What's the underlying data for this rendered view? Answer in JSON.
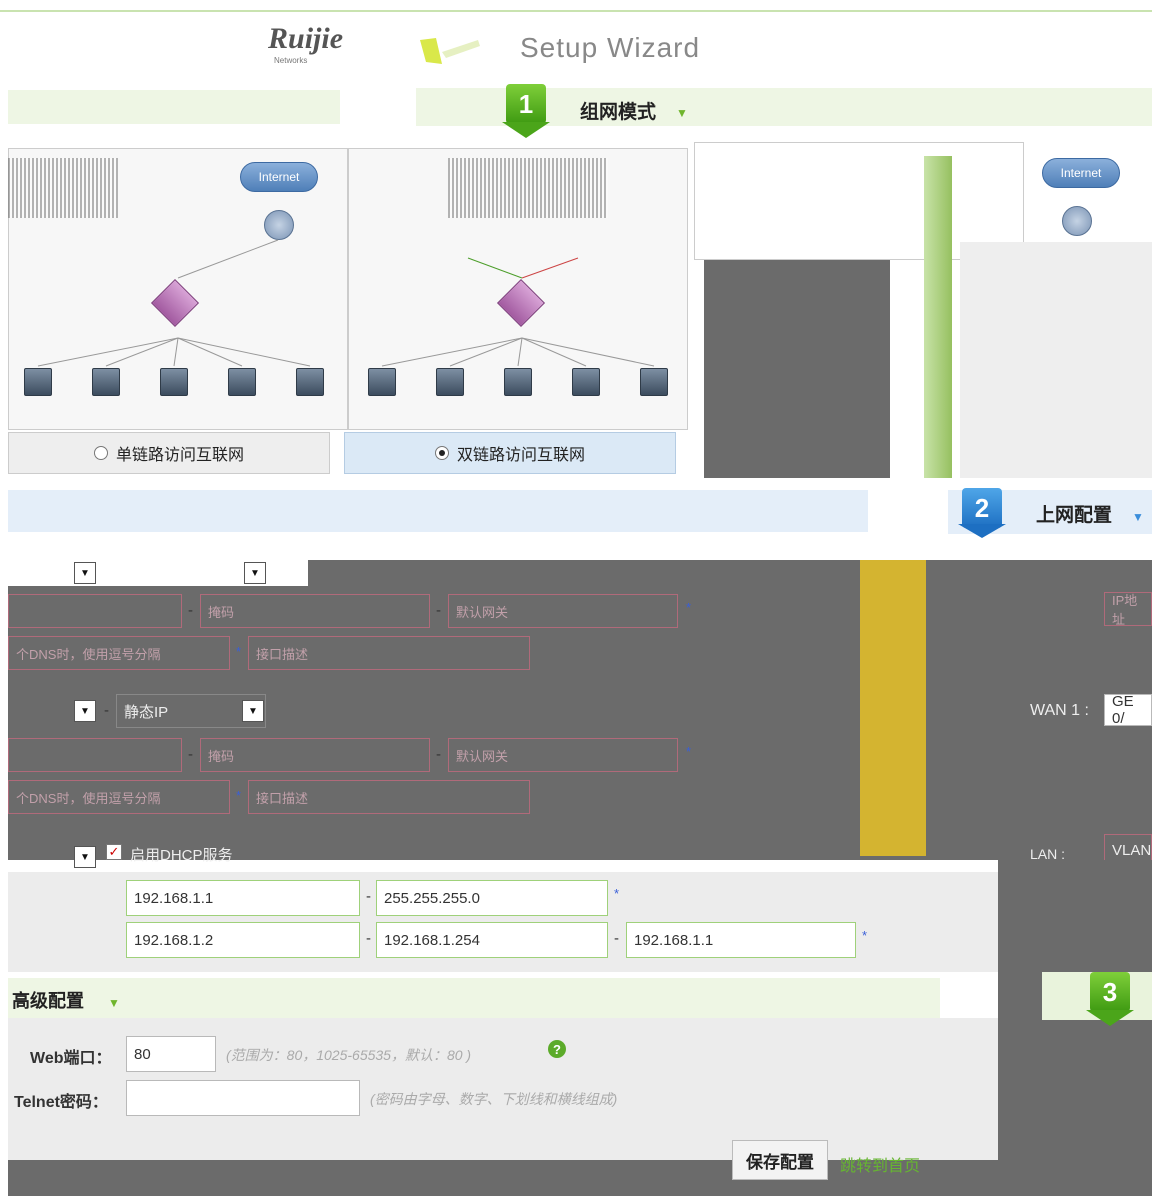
{
  "header": {
    "logo": "Ruijie",
    "logo_sub": "Networks",
    "title": "Setup Wizard"
  },
  "step1": {
    "number": "1",
    "title": "组网模式",
    "caret": "▼"
  },
  "step2": {
    "number": "2",
    "title": "上网配置",
    "caret": "▼"
  },
  "step3": {
    "number": "3"
  },
  "diagrams": {
    "cloud_label": "Internet",
    "single_option": "单链路访问互联网",
    "dual_option": "双链路访问互联网",
    "selected": "dual"
  },
  "form": {
    "row1_select": "静态IP",
    "wan1_label": "WAN 1 :",
    "wan1_value": "GE 0/",
    "ip_placeholder": "IP地址",
    "mask_placeholder": "掩码",
    "gateway_placeholder": "默认网关",
    "dns_hint": "个DNS时，使用逗号分隔",
    "desc_placeholder": "接口描述",
    "lan_label": "LAN :",
    "lan_value": "VLAN",
    "dhcp_label": "启用DHCP服务",
    "dhcp_checked": true,
    "lan_ip": "192.168.1.1",
    "lan_mask": "255.255.255.0",
    "pool_start": "192.168.1.2",
    "pool_end": "192.168.1.254",
    "dhcp_gateway": "192.168.1.1",
    "star": "*",
    "dash": "-"
  },
  "advanced": {
    "title": "高级配置",
    "caret": "▼",
    "web_port_label": "Web端口：",
    "web_port_value": "80",
    "web_port_hint": "(范围为：80，1025-65535，默认：80 )",
    "telnet_label": "Telnet密码：",
    "telnet_value": "",
    "telnet_hint": "(密码由字母、数字、下划线和横线组成)"
  },
  "actions": {
    "save": "保存配置",
    "skip": "跳转到首页"
  }
}
